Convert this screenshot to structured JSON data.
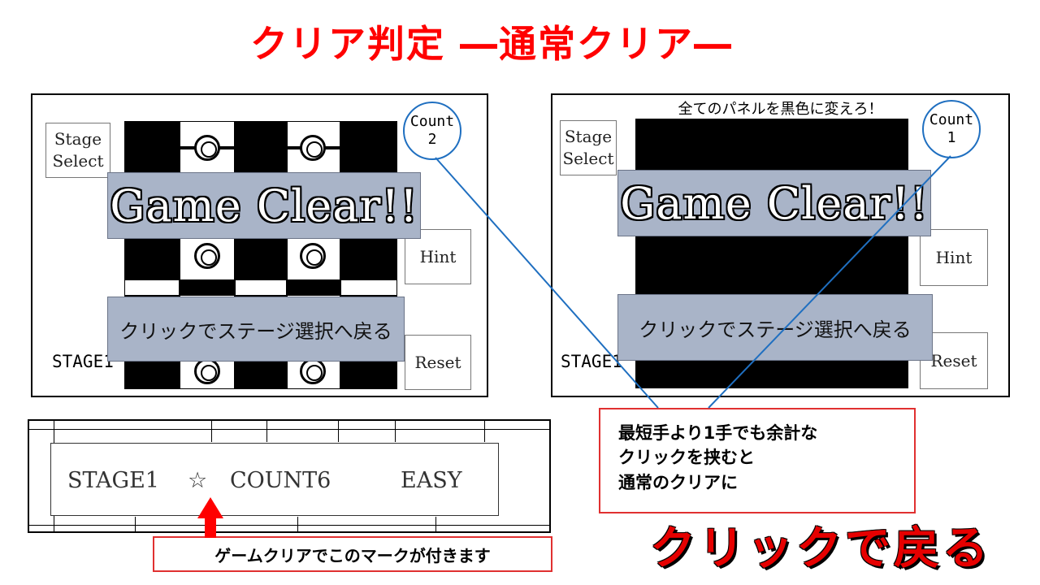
{
  "title": "クリア判定 ―通常クリア―",
  "left_panel": {
    "stage_select": "Stage Select",
    "hint": "Hint",
    "reset": "Reset",
    "stage_label": "STAGE1",
    "count_label": "Count",
    "count_value": "2",
    "game_clear": "Game Clear!!",
    "return_text": "クリックでステージ選択へ戻る"
  },
  "right_panel": {
    "instruction": "全てのパネルを黒色に変えろ！",
    "stage_select": "Stage Select",
    "hint": "Hint",
    "reset": "Reset",
    "stage_label": "STAGE1",
    "count_label": "Count",
    "count_value": "1",
    "game_clear": "Game Clear!!",
    "return_text": "クリックでステージ選択へ戻る"
  },
  "status_bar": {
    "stage": "STAGE1",
    "star": "☆",
    "count": "COUNT6",
    "difficulty": "EASY"
  },
  "callouts": {
    "extra_click_line1": "最短手より1手でも余計な",
    "extra_click_line2": "クリックを挟むと",
    "extra_click_line3": "通常のクリアに",
    "mark_note": "ゲームクリアでこのマークが付きます",
    "click_back": "クリックで戻る"
  },
  "colors": {
    "title_red": "#ff0000",
    "banner_gray_blue": "#a9b4c8",
    "connector_blue": "#1f6fc0",
    "callout_border": "#e03030"
  }
}
